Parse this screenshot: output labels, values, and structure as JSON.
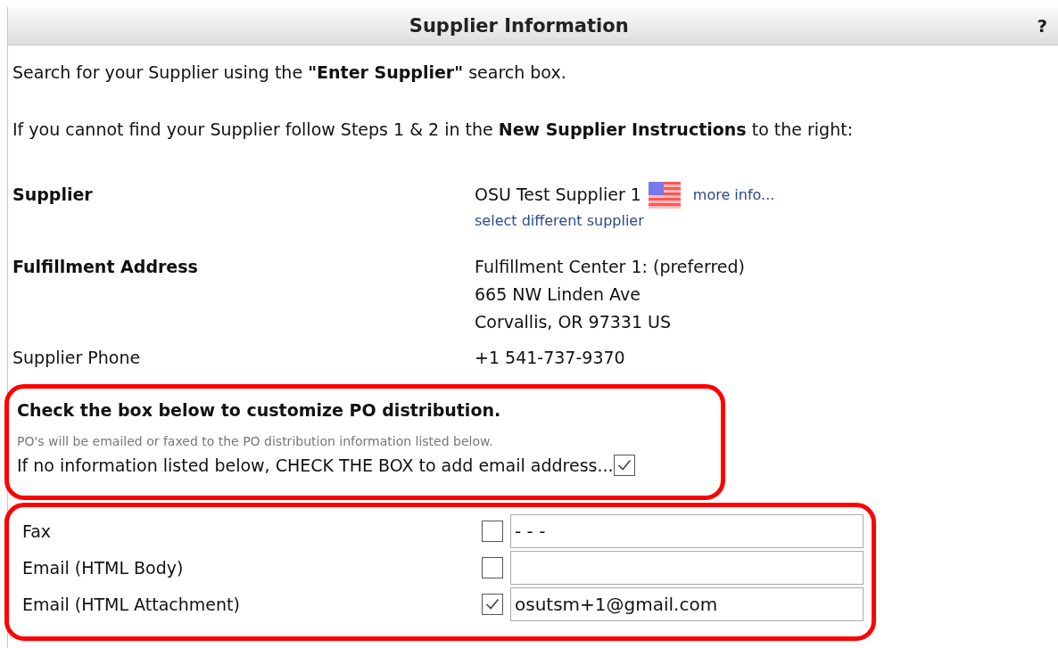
{
  "header": {
    "title": "Supplier Information",
    "help": "?"
  },
  "intro": [
    "Search for your Supplier using the **\"Enter Supplier\"** search box.",
    "If you cannot find your Supplier follow Steps 1 & 2 in the **New Supplier Instructions** to the right:"
  ],
  "supplier": {
    "label": "Supplier",
    "name": "OSU Test Supplier 1",
    "more_info": "more info...",
    "select_link": "select different supplier"
  },
  "address": {
    "label": "Fulfillment Address",
    "lines": [
      "Fulfillment Center 1: (preferred)",
      "665 NW Linden Ave",
      "Corvallis, OR 97331 US"
    ]
  },
  "phone": {
    "label": "Supplier Phone",
    "value": "+1 541-737-9370"
  },
  "customize": {
    "heading": "Check the box below to customize PO distribution.",
    "note": "PO's will be emailed or faxed to the PO distribution information listed below.",
    "prompt": "If no information listed below, CHECK THE BOX to add email address...",
    "checked": true
  },
  "distribution": [
    {
      "label": "Fax",
      "checked": false,
      "value": "- - -"
    },
    {
      "label": "Email (HTML Body)",
      "checked": false
    },
    {
      "label": "Email (HTML Attachment)",
      "checked": true,
      "value": "osutsm+1@gmail.com"
    }
  ]
}
